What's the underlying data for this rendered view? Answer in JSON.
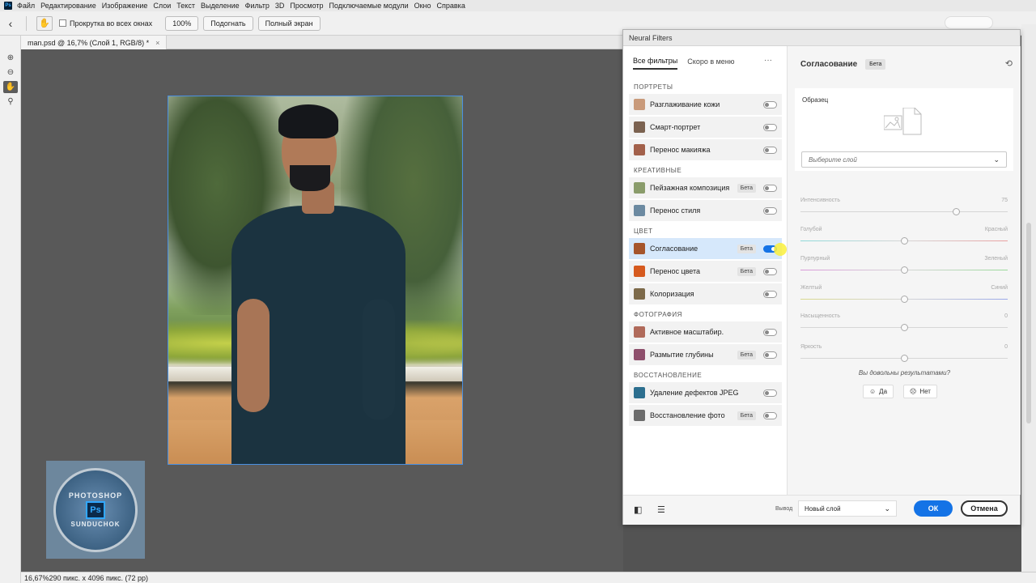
{
  "menubar": {
    "items": [
      "Файл",
      "Редактирование",
      "Изображение",
      "Слои",
      "Текст",
      "Выделение",
      "Фильтр",
      "3D",
      "Просмотр",
      "Подключаемые модули",
      "Окно",
      "Справка"
    ]
  },
  "optionsbar": {
    "scroll_all_label": "Прокрутка во всех окнах",
    "zoom_100": "100%",
    "fit_label": "Подогнать",
    "fullscreen_label": "Полный экран"
  },
  "document": {
    "tab_title": "man.psd @ 16,7% (Слой 1, RGB/8) *"
  },
  "status": {
    "zoom": "16,67%",
    "size": "290 пикс. x 4096 пикс. (72 pp)"
  },
  "watermark": {
    "top": "PHOTOSHOP",
    "ps": "Ps",
    "bottom": "SUNDUCHOK"
  },
  "neural_filters": {
    "window_title": "Neural Filters",
    "tabs": [
      "Все фильтры",
      "Скоро в меню"
    ],
    "more": "···",
    "categories": [
      {
        "name": "ПОРТРЕТЫ",
        "items": [
          {
            "label": "Разглаживание кожи",
            "badge": "",
            "on": false
          },
          {
            "label": "Смарт-портрет",
            "badge": "",
            "on": false
          },
          {
            "label": "Перенос макияжа",
            "badge": "",
            "on": false
          }
        ]
      },
      {
        "name": "КРЕАТИВНЫЕ",
        "items": [
          {
            "label": "Пейзажная композиция",
            "badge": "Бета",
            "on": false
          },
          {
            "label": "Перенос стиля",
            "badge": "",
            "on": false
          }
        ]
      },
      {
        "name": "ЦВЕТ",
        "items": [
          {
            "label": "Согласование",
            "badge": "Бета",
            "on": true
          },
          {
            "label": "Перенос цвета",
            "badge": "Бета",
            "on": false
          },
          {
            "label": "Колоризация",
            "badge": "",
            "on": false
          }
        ]
      },
      {
        "name": "ФОТОГРАФИЯ",
        "items": [
          {
            "label": "Активное масштабир.",
            "badge": "",
            "on": false
          },
          {
            "label": "Размытие глубины",
            "badge": "Бета",
            "on": false
          }
        ]
      },
      {
        "name": "ВОССТАНОВЛЕНИЕ",
        "items": [
          {
            "label": "Удаление дефектов JPEG",
            "badge": "",
            "on": false
          },
          {
            "label": "Восстановление фото",
            "badge": "Бета",
            "on": false
          }
        ]
      }
    ],
    "panel": {
      "title": "Согласование",
      "badge": "Бета",
      "sample_label": "Образец",
      "select_placeholder": "Выберите слой",
      "sliders": [
        {
          "left": "Интенсивность",
          "right": "75",
          "value": 75,
          "min": 0,
          "max": 100
        },
        {
          "left": "Голубой",
          "right": "Красный",
          "value": 0,
          "min": -50,
          "max": 50
        },
        {
          "left": "Пурпурный",
          "right": "Зеленый",
          "value": 0,
          "min": -50,
          "max": 50
        },
        {
          "left": "Желтый",
          "right": "Синий",
          "value": 0,
          "min": -50,
          "max": 50
        },
        {
          "left": "Насыщенность",
          "right": "0",
          "value": 0,
          "min": -50,
          "max": 50
        },
        {
          "left": "Яркость",
          "right": "0",
          "value": 0,
          "min": -50,
          "max": 50
        }
      ],
      "question": "Вы довольны результатами?",
      "yes": "Да",
      "no": "Нет"
    },
    "bottom": {
      "output_label": "Вывод",
      "output_value": "Новый слой",
      "ok": "ОК",
      "cancel": "Отмена"
    }
  }
}
